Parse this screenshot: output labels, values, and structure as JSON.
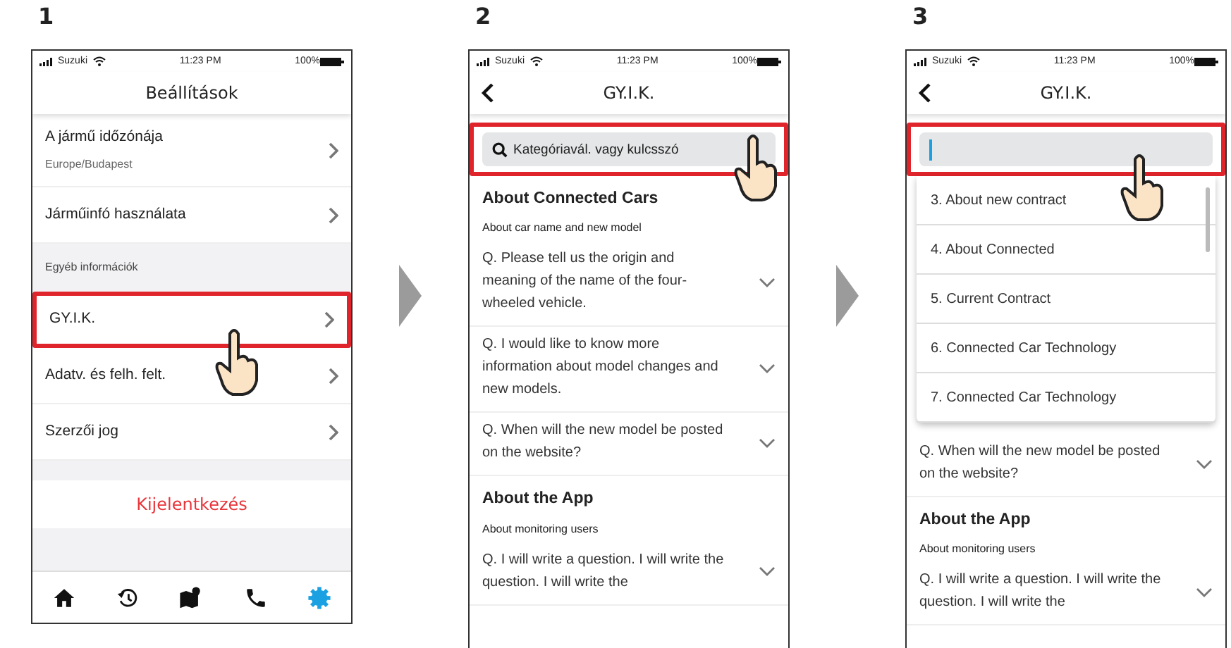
{
  "steps": [
    {
      "number": "1",
      "kind": "settings",
      "status_bar": {
        "carrier": "Suzuki",
        "time": "11:23 PM",
        "battery": "100%"
      },
      "title": "Beállítások",
      "rows": [
        {
          "kind": "item",
          "label": "A jármű időzónája",
          "sublabel": "Europe/Budapest",
          "highlighted": false
        },
        {
          "kind": "item",
          "label": "Járműinfó használata",
          "highlighted": false
        },
        {
          "kind": "section",
          "label": "Egyéb információk"
        },
        {
          "kind": "item",
          "label": "GY.I.K.",
          "highlighted": true
        },
        {
          "kind": "item",
          "label": "Adatv. és felh. felt.",
          "highlighted": false
        },
        {
          "kind": "item",
          "label": "Szerzői jog",
          "highlighted": false
        }
      ],
      "logout": "Kijelentkezés",
      "tabs": [
        {
          "selected": false
        },
        {
          "selected": false
        },
        {
          "selected": false
        },
        {
          "selected": false
        },
        {
          "selected": true
        }
      ]
    },
    {
      "number": "2",
      "kind": "faq",
      "status_bar": {
        "carrier": "Suzuki",
        "time": "11:23 PM",
        "battery": "100%"
      },
      "title": "GY.I.K.",
      "search": {
        "placeholder": "Kategóriavál. vagy kulcsszó",
        "highlighted": true,
        "focused": false
      },
      "sections": [
        {
          "title": "About Connected Cars",
          "subtitle": "About car name and new model",
          "questions": [
            "Q. Please tell us the origin and meaning of the name of the four-wheeled vehicle.",
            "Q. I would like to know more information about model changes and new models.",
            "Q. When will the new model be posted on the website?"
          ]
        },
        {
          "title": "About the App",
          "subtitle": "About monitoring users",
          "questions": [
            "Q. I will write a question. I will write the question. I will write the"
          ]
        }
      ]
    },
    {
      "number": "3",
      "kind": "faq",
      "status_bar": {
        "carrier": "Suzuki",
        "time": "11:23 PM",
        "battery": "100%"
      },
      "title": "GY.I.K.",
      "search": {
        "highlighted": true,
        "focused": true
      },
      "dropdown": [
        "3. About new contract",
        "4. About Connected",
        "5. Current Contract",
        "6. Connected Car Technology",
        "7. Connected Car Technology"
      ],
      "sections": [
        {
          "questions": [
            "Q. When will the new model be posted on the website?"
          ]
        },
        {
          "title": "About the App",
          "subtitle": "About monitoring users",
          "questions": [
            "Q. I will write a question. I will write the question. I will write the"
          ]
        }
      ]
    }
  ]
}
